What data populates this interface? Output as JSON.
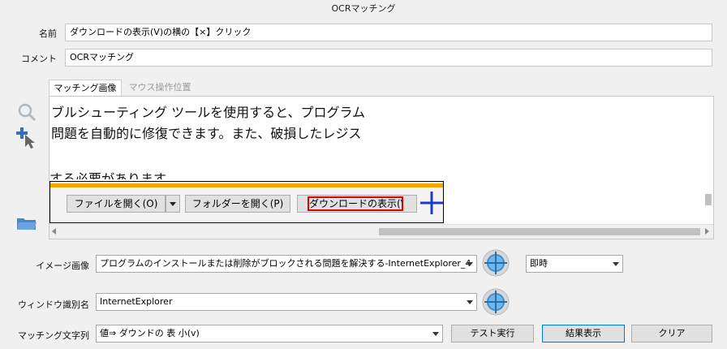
{
  "window": {
    "title": "OCRマッチング"
  },
  "form": {
    "name_label": "名前",
    "name_value": "ダウンロードの表示(V)の横の【×】クリック",
    "comment_label": "コメント",
    "comment_value": "OCRマッチング"
  },
  "tabs": [
    {
      "label": "マッチング画像",
      "active": true
    },
    {
      "label": "マウス操作位置",
      "active": false
    }
  ],
  "preview": {
    "lines": [
      "ブルシューティング ツールを使用すると、プログラム",
      "問題を自動的に修復できます。また、破損したレジス",
      "する必要があります"
    ],
    "buttons": {
      "open_file": "ファイルを開く(O)",
      "open_folder": "フォルダーを開く(P)",
      "show_downloads": "ダウンロードの表示(V)"
    }
  },
  "image_row": {
    "label": "イメージ画像",
    "value": "プログラムのインストールまたは削除がブロックされる問題を解決する-InternetExplorer_4",
    "timing_value": "即時"
  },
  "window_row": {
    "label": "ウィンドウ識別名",
    "value": "InternetExplorer"
  },
  "match_row": {
    "label": "マッチング文字列",
    "value": "値⇒ ダウンドの 表 小(v)"
  },
  "actions": {
    "test": "テスト実行",
    "result": "結果表示",
    "clear": "クリア"
  },
  "colors": {
    "accent": "#0078d7",
    "red_box": "#e00000",
    "ie_bar": "#f0a800",
    "cursor": "#1a3cc8"
  }
}
